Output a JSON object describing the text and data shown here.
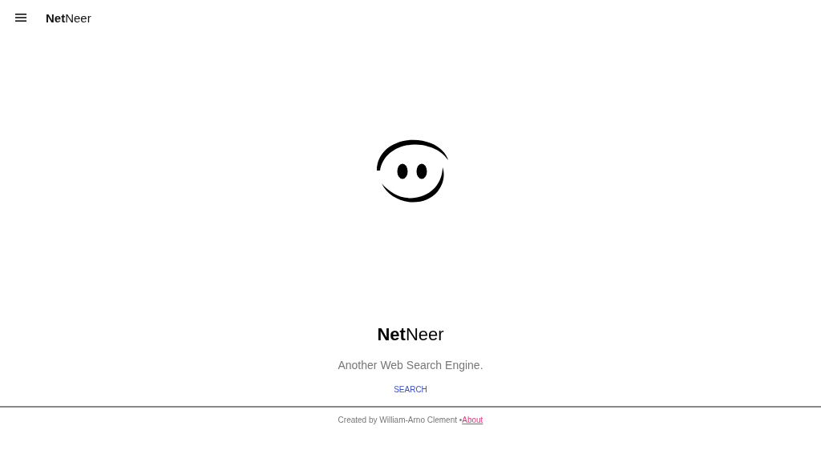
{
  "header": {
    "brand": "**Net**Neer"
  },
  "hero": {
    "title": "**Net**Neer",
    "tagline": "Another Web Search Engine.",
    "action": "SEARCH"
  },
  "footer": {
    "credit": "Created by William-Arno Clement •",
    "link": "About"
  }
}
